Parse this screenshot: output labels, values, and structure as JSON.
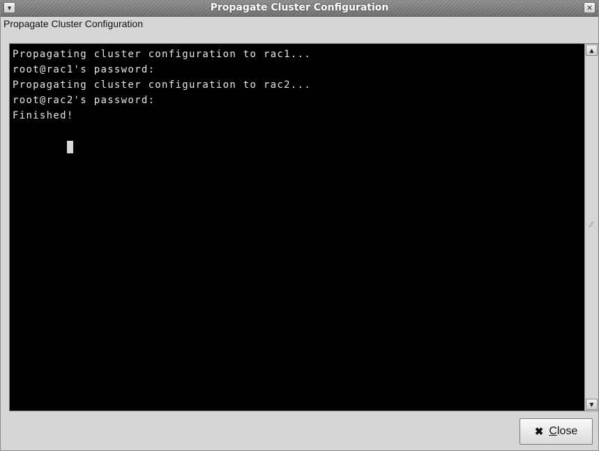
{
  "window": {
    "title": "Propagate Cluster Configuration"
  },
  "header": {
    "label": "Propagate Cluster Configuration"
  },
  "terminal": {
    "lines": [
      "Propagating cluster configuration to rac1...",
      "root@rac1's password:",
      "Propagating cluster configuration to rac2...",
      "root@rac2's password:",
      "Finished!"
    ]
  },
  "footer": {
    "close_label": "Close"
  },
  "icons": {
    "window_menu": "chevron-down-icon",
    "window_close": "close-icon",
    "close_button": "x-icon",
    "scroll_up": "arrow-up-icon",
    "scroll_down": "arrow-down-icon"
  }
}
